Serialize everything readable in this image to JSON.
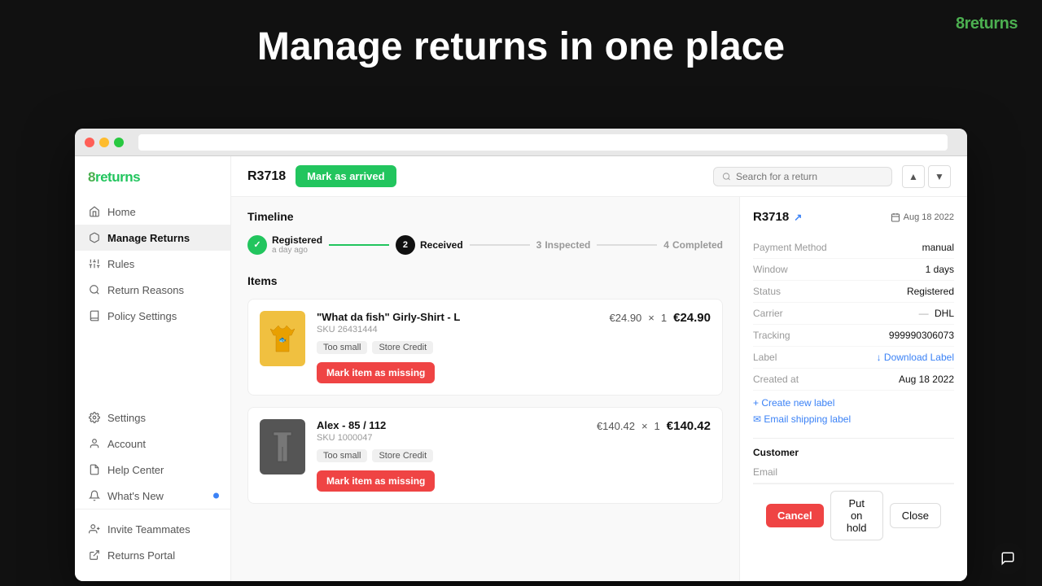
{
  "app": {
    "name": "8returns",
    "logo_prefix": "8",
    "logo_suffix": "returns"
  },
  "hero": {
    "title": "Manage returns in one place"
  },
  "browser": {
    "url": ""
  },
  "sidebar": {
    "logo_prefix": "8",
    "logo_suffix": "returns",
    "nav_items": [
      {
        "id": "home",
        "label": "Home",
        "icon": "home",
        "active": false
      },
      {
        "id": "manage-returns",
        "label": "Manage Returns",
        "icon": "package",
        "active": true
      },
      {
        "id": "rules",
        "label": "Rules",
        "icon": "sliders",
        "active": false
      },
      {
        "id": "return-reasons",
        "label": "Return Reasons",
        "icon": "search",
        "active": false
      },
      {
        "id": "policy-settings",
        "label": "Policy Settings",
        "icon": "book",
        "active": false
      }
    ],
    "bottom_items": [
      {
        "id": "settings",
        "label": "Settings",
        "icon": "gear"
      },
      {
        "id": "account",
        "label": "Account",
        "icon": "user"
      },
      {
        "id": "help-center",
        "label": "Help Center",
        "icon": "doc"
      },
      {
        "id": "whats-new",
        "label": "What's New",
        "icon": "bell",
        "badge": true
      }
    ],
    "footer_items": [
      {
        "id": "invite-teammates",
        "label": "Invite Teammates",
        "icon": "person-plus"
      },
      {
        "id": "returns-portal",
        "label": "Returns Portal",
        "icon": "external"
      }
    ]
  },
  "topbar": {
    "return_id": "R3718",
    "mark_arrived_label": "Mark as arrived",
    "search_placeholder": "Search for a return"
  },
  "timeline": {
    "title": "Timeline",
    "steps": [
      {
        "num": "",
        "label": "Registered",
        "sub": "a day ago",
        "state": "completed",
        "icon": "✓"
      },
      {
        "num": "2",
        "label": "Received",
        "sub": "",
        "state": "active"
      },
      {
        "num": "3",
        "label": "Inspected",
        "sub": "",
        "state": "inactive"
      },
      {
        "num": "4",
        "label": "Completed",
        "sub": "",
        "state": "inactive"
      }
    ]
  },
  "items": {
    "section_title": "Items",
    "list": [
      {
        "name": "\"What da fish\" Girly-Shirt - L",
        "sku_label": "SKU",
        "sku": "26431444",
        "tags": [
          "Too small",
          "Store Credit"
        ],
        "unit_price": "€24.90",
        "quantity": "1",
        "total": "€24.90",
        "action": "Mark item as missing",
        "img_color": "#f0c040"
      },
      {
        "name": "Alex - 85 / 112",
        "sku_label": "SKU",
        "sku": "1000047",
        "tags": [
          "Too small",
          "Store Credit"
        ],
        "unit_price": "€140.42",
        "quantity": "1",
        "total": "€140.42",
        "action": "Mark item as missing",
        "img_color": "#555"
      }
    ]
  },
  "right_panel": {
    "return_id": "R3718",
    "date": "Aug 18 2022",
    "info_rows": [
      {
        "label": "Payment Method",
        "value": "manual"
      },
      {
        "label": "Window",
        "value": "1 days"
      },
      {
        "label": "Status",
        "value": "Registered"
      },
      {
        "label": "Carrier",
        "value": "DHL"
      },
      {
        "label": "Tracking",
        "value": "999990306073"
      },
      {
        "label": "Label",
        "value": ""
      },
      {
        "label": "Created at",
        "value": "Aug 18 2022"
      }
    ],
    "download_label": "↓ Download Label",
    "create_new_label": "+ Create new label",
    "email_shipping_label": "✉ Email shipping label",
    "customer_section": "Customer",
    "email_label": "Email"
  },
  "action_bar": {
    "cancel_label": "Cancel",
    "hold_label": "Put on hold",
    "close_label": "Close"
  }
}
